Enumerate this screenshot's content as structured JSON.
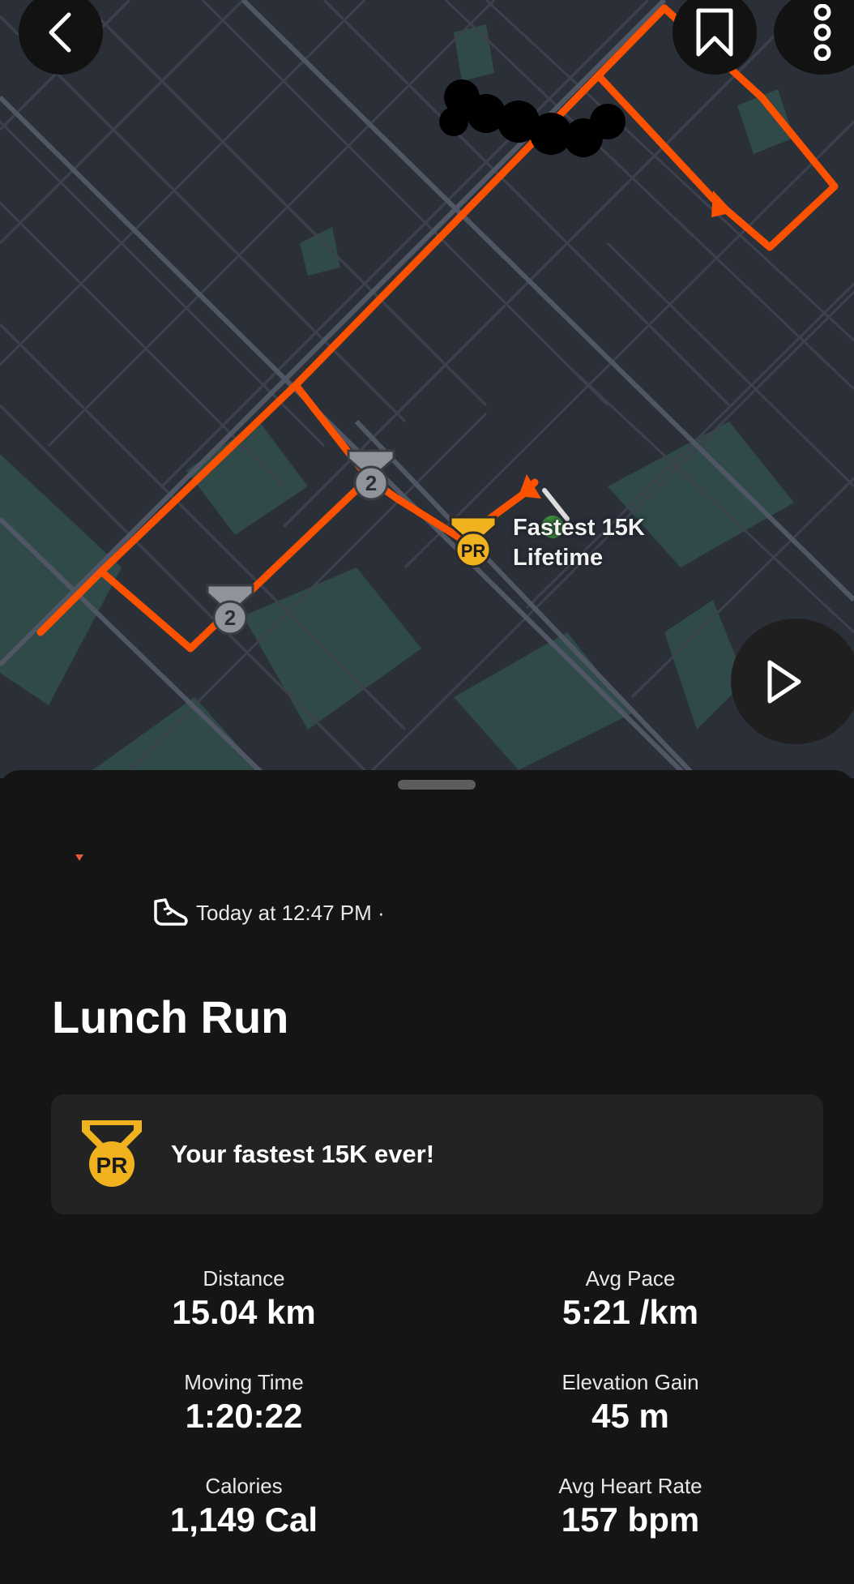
{
  "map": {
    "pr_label_line1": "Fastest 15K",
    "pr_label_line2": "Lifetime",
    "medal_badge_a": "2",
    "medal_badge_b": "2",
    "pr_badge": "PR",
    "route_color": "#fc5200",
    "pr_medal_color": "#f0b21f",
    "silver_medal_color": "#8e9499"
  },
  "toolbar": {
    "back_icon": "chevron-left-icon",
    "bookmark_icon": "bookmark-icon",
    "more_icon": "more-vertical-icon",
    "replay_icon": "play-icon"
  },
  "activity": {
    "sport_icon": "running-shoe-icon",
    "timestamp": "Today at 12:47 PM ·",
    "title": "Lunch Run",
    "pr_message": "Your fastest 15K ever!",
    "pr_badge": "PR"
  },
  "stats": [
    {
      "label": "Distance",
      "value": "15.04 km"
    },
    {
      "label": "Avg Pace",
      "value": "5:21 /km"
    },
    {
      "label": "Moving Time",
      "value": "1:20:22"
    },
    {
      "label": "Elevation Gain",
      "value": "45 m"
    },
    {
      "label": "Calories",
      "value": "1,149 Cal"
    },
    {
      "label": "Avg Heart Rate",
      "value": "157 bpm"
    }
  ]
}
